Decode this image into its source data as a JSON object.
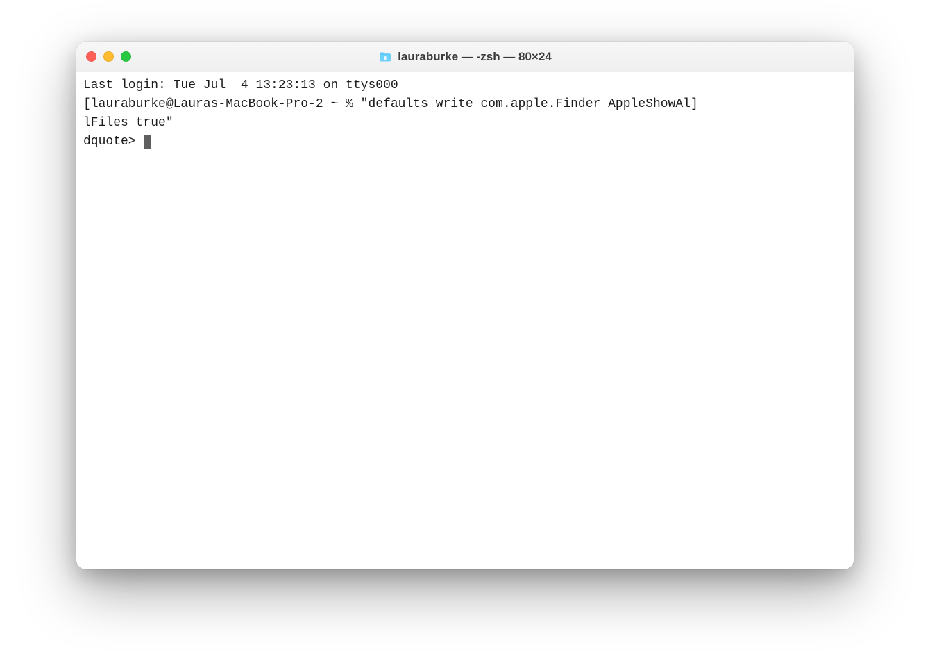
{
  "window": {
    "title": "lauraburke — -zsh — 80×24"
  },
  "terminal": {
    "line1": "Last login: Tue Jul  4 13:23:13 on ttys000",
    "line2_prompt": "[lauraburke@Lauras-MacBook-Pro-2 ~ % ",
    "line2_cmd_part1": "\"defaults write com.apple.Finder AppleShowAl]",
    "line3": "lFiles true\"",
    "line4_prompt": "dquote> "
  },
  "colors": {
    "close": "#ff5f57",
    "minimize": "#febc2e",
    "zoom": "#28c840"
  }
}
